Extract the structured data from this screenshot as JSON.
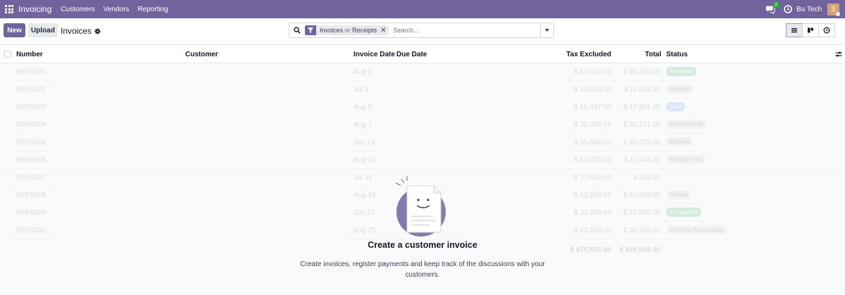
{
  "navbar": {
    "app_name": "Invoicing",
    "menu": [
      "Customers",
      "Vendors",
      "Reporting"
    ],
    "chat_count": "2",
    "company": "Bu Tech",
    "avatar_letter": "S",
    "bg_color": "#71639e"
  },
  "control": {
    "new_label": "New",
    "upload_label": "Upload",
    "page_title": "Invoices",
    "facet_part1": "Invoices",
    "facet_or": "or",
    "facet_part2": "Receipts",
    "facet_remove": "✕",
    "search_placeholder": "Search..."
  },
  "table": {
    "columns": {
      "number": "Number",
      "customer": "Customer",
      "invoice_date": "Invoice Date",
      "due_date": "Due Date",
      "tax_excluded": "Tax Excluded",
      "total": "Total",
      "status": "Status"
    },
    "rows": [
      {
        "number": "REF0001",
        "date": "Aug 9",
        "tax": "$ 57,622.00",
        "total": "$ 55,430.00",
        "status": "Received",
        "status_style": "green"
      },
      {
        "number": "REF0002",
        "date": "Jul 9",
        "tax": "$ 10,663.00",
        "total": "$ 11,614.00",
        "status": "Blocked",
        "status_style": "gray"
      },
      {
        "number": "REF0003",
        "date": "Aug 8",
        "tax": "$ 16,497.00",
        "total": "$ 17,801.00",
        "status": "Draft",
        "status_style": "blue"
      },
      {
        "number": "REF0004",
        "date": "Aug 7",
        "tax": "$ 35,252.00",
        "total": "$ 35,271.00",
        "status": "Partially Paid",
        "status_style": "gray"
      },
      {
        "number": "REF0005",
        "date": "Jun 19",
        "tax": "$ 95,846.00",
        "total": "$ 91,373.00",
        "status": "Blocked",
        "status_style": "gray"
      },
      {
        "number": "REF0006",
        "date": "Aug 21",
        "tax": "$ 60,052.00",
        "total": "$ 11,744.00",
        "status": "Partially Paid",
        "status_style": "gray"
      },
      {
        "number": "REF0007",
        "date": "Jul 14",
        "tax": "$ 77,600.00",
        "total": "$ 246.00",
        "status": "",
        "status_style": ""
      },
      {
        "number": "REF0008",
        "date": "Aug 13",
        "tax": "$ 12,806.00",
        "total": "$ 46,993.00",
        "status": "Posted",
        "status_style": "gray"
      },
      {
        "number": "REF0009",
        "date": "Jun 21",
        "tax": "$ 31,965.00",
        "total": "$ 70,565.00",
        "status": "In Payment",
        "status_style": "green"
      },
      {
        "number": "REF0010",
        "date": "Aug 25",
        "tax": "$ 43,528.00",
        "total": "$ 30,565.00",
        "status": "Invoicing App Legacy",
        "status_style": "gray"
      }
    ],
    "sum_tax": "$ 475,555.00",
    "sum_total": "$ 428,066.00"
  },
  "helper": {
    "title": "Create a customer invoice",
    "description": "Create invoices, register payments and keep track of the discussions with your customers."
  }
}
